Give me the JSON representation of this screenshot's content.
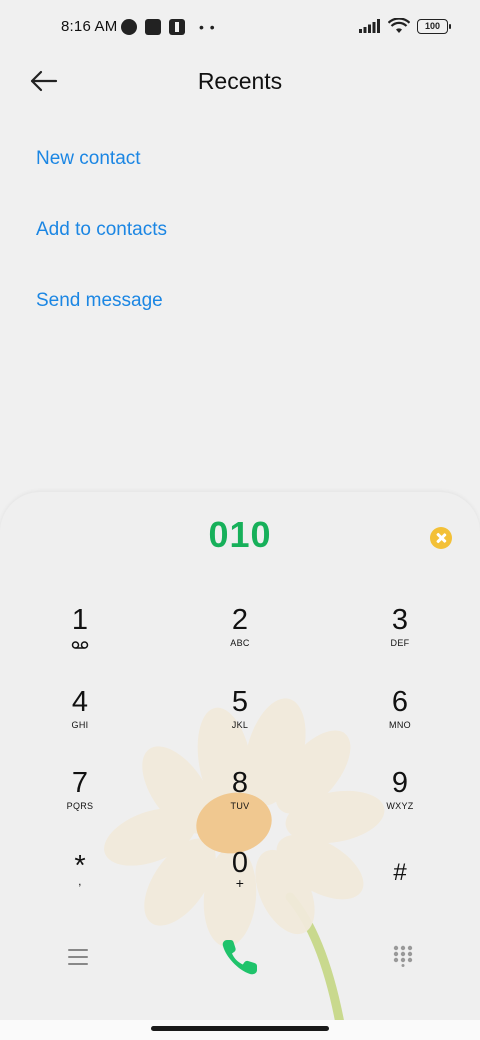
{
  "status_bar": {
    "time": "8:16 AM",
    "battery": "100",
    "icons": [
      "vpn-icon",
      "square-notification-icon",
      "upload-icon",
      "more-notifications-icon",
      "signal-icon",
      "wifi-icon",
      "battery-icon"
    ]
  },
  "toolbar": {
    "back_icon": "arrow-left-icon",
    "title": "Recents"
  },
  "actions": {
    "new_contact": "New contact",
    "add_to_contacts": "Add to contacts",
    "send_message": "Send message"
  },
  "dialpad": {
    "entered_number": "010",
    "keys": [
      {
        "digit": "1",
        "letters": ""
      },
      {
        "digit": "2",
        "letters": "ABC"
      },
      {
        "digit": "3",
        "letters": "DEF"
      },
      {
        "digit": "4",
        "letters": "GHI"
      },
      {
        "digit": "5",
        "letters": "JKL"
      },
      {
        "digit": "6",
        "letters": "MNO"
      },
      {
        "digit": "7",
        "letters": "PQRS"
      },
      {
        "digit": "8",
        "letters": "TUV"
      },
      {
        "digit": "9",
        "letters": "WXYZ"
      },
      {
        "digit": "*",
        "letters": ","
      },
      {
        "digit": "0",
        "letters": "+"
      },
      {
        "digit": "#",
        "letters": ""
      }
    ]
  },
  "colors": {
    "accent_blue": "#1b86e3",
    "number_green": "#17b05a",
    "call_green": "#1fc36b",
    "clear_yellow": "#f3c037"
  }
}
